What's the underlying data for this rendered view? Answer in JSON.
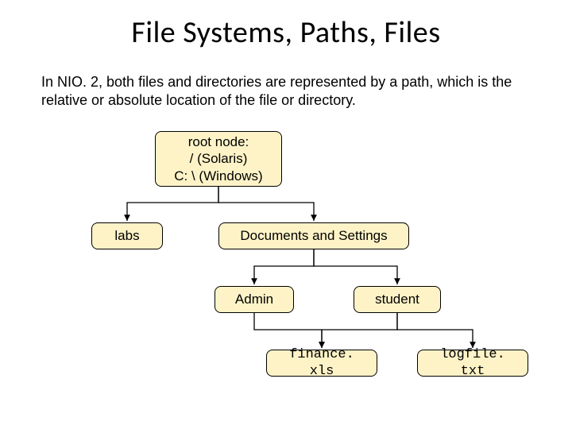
{
  "title": "File Systems, Paths, Files",
  "description": "In NIO. 2, both files and directories are represented by a path, which is the relative or absolute location of the file or directory.",
  "nodes": {
    "root_line1": "root node:",
    "root_line2": "/ (Solaris)",
    "root_line3": "C: \\ (Windows)",
    "labs": "labs",
    "docs": "Documents and Settings",
    "admin": "Admin",
    "student": "student",
    "finance": "finance. xls",
    "logfile": "logfile. txt"
  }
}
